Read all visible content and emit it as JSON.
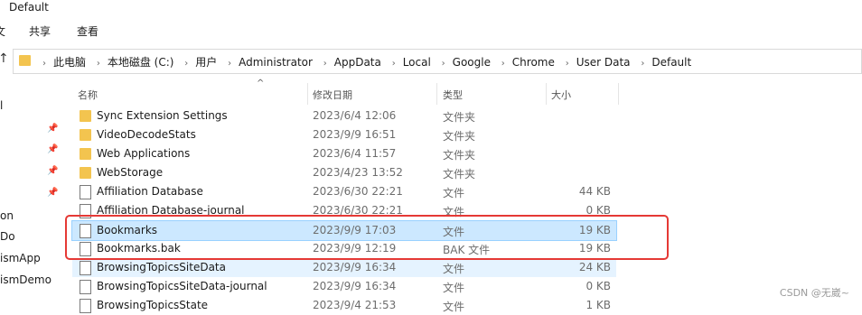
{
  "window": {
    "title": "Default"
  },
  "ribbon": {
    "tabs": [
      "文",
      "共享",
      "查看"
    ]
  },
  "address": {
    "crumbs": [
      "此电脑",
      "本地磁盘 (C:)",
      "用户",
      "Administrator",
      "AppData",
      "Local",
      "Google",
      "Chrome",
      "User Data",
      "Default"
    ]
  },
  "sidebar": {
    "labels": [
      "l",
      "on",
      "Do",
      "ismApp",
      "ismDemo"
    ]
  },
  "columns": {
    "name": "名称",
    "date": "修改日期",
    "type": "类型",
    "size": "大小"
  },
  "files": [
    {
      "name": "Sync Extension Settings",
      "date": "2023/6/4 12:06",
      "type": "文件夹",
      "size": "",
      "kind": "folder"
    },
    {
      "name": "VideoDecodeStats",
      "date": "2023/9/9 16:51",
      "type": "文件夹",
      "size": "",
      "kind": "folder"
    },
    {
      "name": "Web Applications",
      "date": "2023/6/4 11:57",
      "type": "文件夹",
      "size": "",
      "kind": "folder"
    },
    {
      "name": "WebStorage",
      "date": "2023/4/23 13:52",
      "type": "文件夹",
      "size": "",
      "kind": "folder"
    },
    {
      "name": "Affiliation Database",
      "date": "2023/6/30 22:21",
      "type": "文件",
      "size": "44 KB",
      "kind": "file"
    },
    {
      "name": "Affiliation Database-journal",
      "date": "2023/6/30 22:21",
      "type": "文件",
      "size": "0 KB",
      "kind": "file"
    },
    {
      "name": "Bookmarks",
      "date": "2023/9/9 17:03",
      "type": "文件",
      "size": "19 KB",
      "kind": "file",
      "state": "selected"
    },
    {
      "name": "Bookmarks.bak",
      "date": "2023/9/9 12:19",
      "type": "BAK 文件",
      "size": "19 KB",
      "kind": "file"
    },
    {
      "name": "BrowsingTopicsSiteData",
      "date": "2023/9/9 16:34",
      "type": "文件",
      "size": "24 KB",
      "kind": "file",
      "state": "hover"
    },
    {
      "name": "BrowsingTopicsSiteData-journal",
      "date": "2023/9/9 16:34",
      "type": "文件",
      "size": "0 KB",
      "kind": "file"
    },
    {
      "name": "BrowsingTopicsState",
      "date": "2023/9/4 21:53",
      "type": "文件",
      "size": "1 KB",
      "kind": "file"
    }
  ],
  "watermark": "CSDN @无崴~",
  "colors": {
    "selection": "#cce8ff",
    "highlight": "#e53935",
    "folder": "#f3c44f"
  }
}
